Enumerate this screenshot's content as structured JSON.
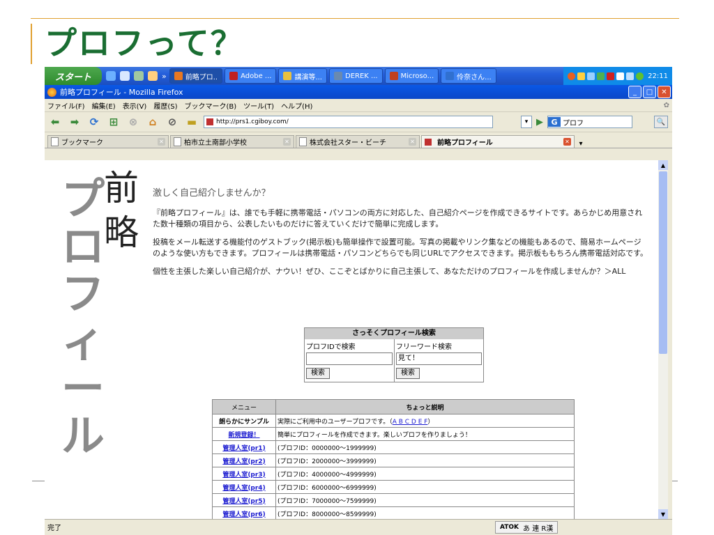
{
  "slide": {
    "title": "プロフって？"
  },
  "taskbar": {
    "start_label": "スタート",
    "quick_more": "»",
    "tasks": [
      {
        "label": "前略プロ..",
        "color": "#e87820"
      },
      {
        "label": "Adobe ...",
        "color": "#c02020"
      },
      {
        "label": "講演等...",
        "color": "#e8c040"
      },
      {
        "label": "DEREK ...",
        "color": "#6a8ab0"
      },
      {
        "label": "Microso...",
        "color": "#c04020"
      },
      {
        "label": "伶奈さん...",
        "color": "#3070d0"
      }
    ],
    "clock": "22:11"
  },
  "browser": {
    "window_title": "前略プロフィール - Mozilla Firefox",
    "menus": [
      "ファイル(F)",
      "編集(E)",
      "表示(V)",
      "履歴(S)",
      "ブックマーク(B)",
      "ツール(T)",
      "ヘルプ(H)"
    ],
    "url": "http://prs1.cgiboy.com/",
    "search_value": "プロフ",
    "tabs": [
      {
        "label": "ブックマーク"
      },
      {
        "label": "柏市立土南部小学校"
      },
      {
        "label": "株式会社スター・ビーチ"
      },
      {
        "label": "前略プロフィール"
      }
    ],
    "status": "完了",
    "ime": {
      "brand": "ATOK",
      "mode": "あ 連 R漢"
    }
  },
  "page": {
    "logo_main": "プロフィール",
    "logo_brush": "前略",
    "heading": "激しく自己紹介しませんか？",
    "para1": "『前略プロフィール』は、誰でも手軽に携帯電話・パソコンの両方に対応した、自己紹介ページを作成できるサイトです。あらかじめ用意された数十種類の項目から、公表したいものだけに答えていくだけで簡単に完成します。",
    "para2": "投稿をメール転送する機能付のゲストブック(掲示板)も簡単操作で設置可能。写真の掲載やリンク集などの機能もあるので、簡易ホームページのような使い方もできます。プロフィールは携帯電話・パソコンどちらでも同じURLでアクセスできます。掲示板ももちろん携帯電話対応です。",
    "para3": "個性を主張した楽しい自己紹介が、ナウい！ぜひ、ここぞとばかりに自己主張して、あなただけのプロフィールを作成しませんか？＞ALL",
    "search": {
      "title": "さっそくプロフィール検索",
      "id_label": "プロフIDで検索",
      "id_value": "",
      "free_label": "フリーワード検索",
      "free_value": "見て！",
      "button": "検索"
    },
    "menu_table": {
      "col1": "メニュー",
      "col2": "ちょっと説明",
      "rows": [
        {
          "menu": "朗らかにサンプル",
          "desc": "実際にご利用中のユーザープロフです。（",
          "links": "A B C D E F",
          "tail": "）"
        },
        {
          "menu": "新規登録！",
          "desc": "簡単にプロフィールを作成できます。楽しいプロフを作りましょう！"
        },
        {
          "menu": "管理人室(pr1)",
          "desc": "(プロフID：0000000～1999999)"
        },
        {
          "menu": "管理人室(pr2)",
          "desc": "(プロフID：2000000～3999999)"
        },
        {
          "menu": "管理人室(pr3)",
          "desc": "(プロフID：4000000～4999999)"
        },
        {
          "menu": "管理人室(pr4)",
          "desc": "(プロフID：6000000～6999999)"
        },
        {
          "menu": "管理人室(pr5)",
          "desc": "(プロフID：7000000～7599999)"
        },
        {
          "menu": "管理人室(pr6)",
          "desc": "(プロフID：8000000～8599999)"
        }
      ]
    }
  }
}
